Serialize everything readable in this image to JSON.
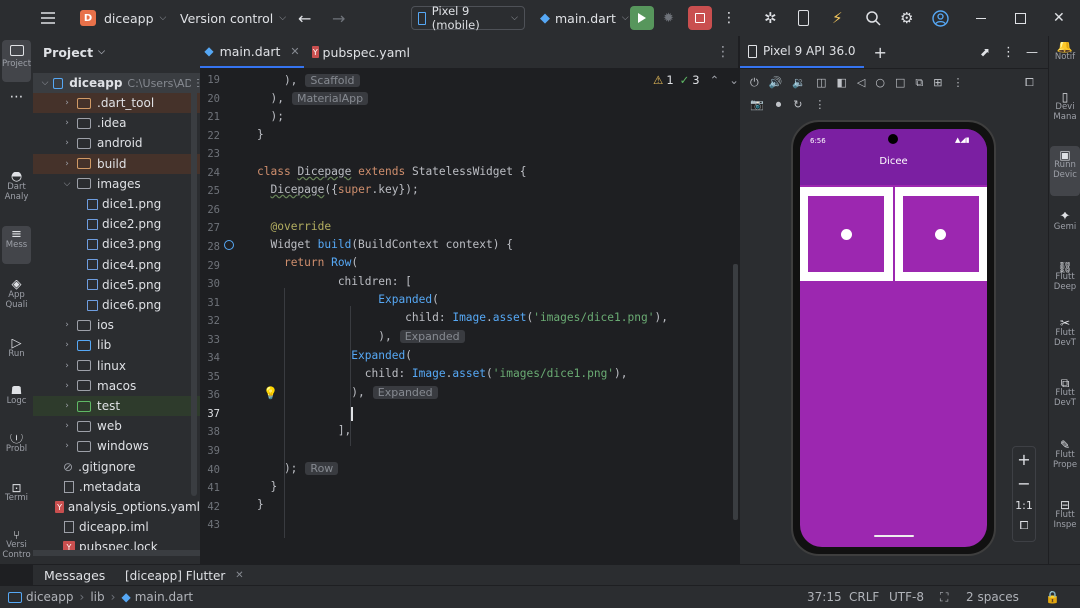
{
  "titlebar": {
    "project_badge": "D",
    "project_name": "diceapp",
    "version_control": "Version control",
    "device": "Pixel 9 (mobile)",
    "run_config": "main.dart"
  },
  "left_strip": {
    "project": "Project",
    "dart_analysis": "Dart Analy",
    "messages": "Mess",
    "app_quality": "App Quali",
    "run": "Run",
    "logcat": "Logc",
    "problems": "Probl",
    "terminal": "Termi",
    "version_control": "Versi Contro"
  },
  "project_panel": {
    "header": "Project",
    "root_name": "diceapp",
    "root_path": "C:\\Users\\ADE",
    "items": [
      {
        "name": ".dart_tool",
        "type": "folder-orange",
        "indent": 1,
        "expanded": false
      },
      {
        "name": ".idea",
        "type": "folder",
        "indent": 1,
        "expanded": false
      },
      {
        "name": "android",
        "type": "folder",
        "indent": 1,
        "expanded": false
      },
      {
        "name": "build",
        "type": "folder-orange",
        "indent": 1,
        "expanded": false
      },
      {
        "name": "images",
        "type": "folder",
        "indent": 1,
        "expanded": true
      },
      {
        "name": "dice1.png",
        "type": "image",
        "indent": 2
      },
      {
        "name": "dice2.png",
        "type": "image",
        "indent": 2
      },
      {
        "name": "dice3.png",
        "type": "image",
        "indent": 2
      },
      {
        "name": "dice4.png",
        "type": "image",
        "indent": 2
      },
      {
        "name": "dice5.png",
        "type": "image",
        "indent": 2
      },
      {
        "name": "dice6.png",
        "type": "image",
        "indent": 2
      },
      {
        "name": "ios",
        "type": "folder",
        "indent": 1,
        "expanded": false
      },
      {
        "name": "lib",
        "type": "folder",
        "indent": 1,
        "expanded": false
      },
      {
        "name": "linux",
        "type": "folder",
        "indent": 1,
        "expanded": false
      },
      {
        "name": "macos",
        "type": "folder",
        "indent": 1,
        "expanded": false
      },
      {
        "name": "test",
        "type": "folder",
        "indent": 1,
        "expanded": false
      },
      {
        "name": "web",
        "type": "folder",
        "indent": 1,
        "expanded": false
      },
      {
        "name": "windows",
        "type": "folder",
        "indent": 1,
        "expanded": false
      },
      {
        "name": ".gitignore",
        "type": "gitignore",
        "indent": 1
      },
      {
        "name": ".metadata",
        "type": "text",
        "indent": 1
      },
      {
        "name": "analysis_options.yaml",
        "type": "yaml",
        "indent": 1
      },
      {
        "name": "diceapp.iml",
        "type": "text",
        "indent": 1
      },
      {
        "name": "pubspec.lock",
        "type": "yaml",
        "indent": 1
      }
    ]
  },
  "editor_tabs": [
    {
      "label": "main.dart",
      "active": true
    },
    {
      "label": "pubspec.yaml",
      "active": false
    }
  ],
  "editor": {
    "warnings": "1",
    "checks": "3",
    "line_numbers": [
      "19",
      "20",
      "21",
      "22",
      "23",
      "24",
      "25",
      "26",
      "27",
      "28",
      "29",
      "30",
      "31",
      "32",
      "33",
      "34",
      "35",
      "36",
      "37",
      "38",
      "39",
      "40",
      "41",
      "42",
      "43"
    ],
    "hints": {
      "scaffold": "Scaffold",
      "material_app": "MaterialApp",
      "expanded1": "Expanded",
      "expanded2": "Expanded",
      "row": "Row"
    }
  },
  "emulator": {
    "title": "Pixel 9 API 36.0",
    "status_time": "6:56",
    "app_title": "Dicee",
    "zoom_ratio": "1:1",
    "accent_color": "#9c27b0"
  },
  "right_strip": {
    "notifications": "Notif",
    "device_manager": "Devi Mana",
    "running_devices": "Runn Devic",
    "gemini": "Gemi",
    "flutter_deep": "Flutt Deep",
    "flutter_devtools": "Flutt DevT",
    "flutter_devtools2": "Flutt DevT",
    "flutter_properties": "Flutt Prope",
    "flutter_inspector": "Flutt Inspe"
  },
  "bottom_tabs": {
    "messages": "Messages",
    "flutter": "[diceapp] Flutter"
  },
  "statusbar": {
    "crumb_project": "diceapp",
    "crumb_lib": "lib",
    "crumb_file": "main.dart",
    "position": "37:15",
    "line_sep": "CRLF",
    "encoding": "UTF-8",
    "indent": "2 spaces"
  }
}
